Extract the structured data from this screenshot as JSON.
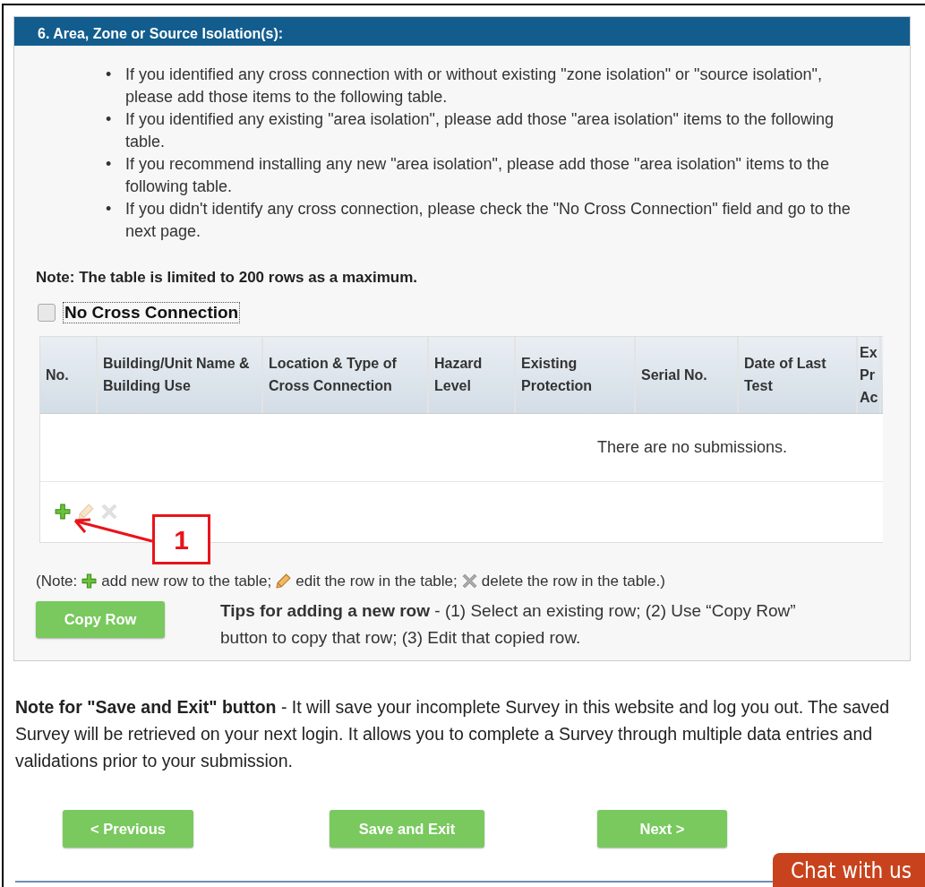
{
  "section": {
    "title": "6. Area, Zone or Source Isolation(s):"
  },
  "instructions": [
    {
      "bullet": "•",
      "text": "If you identified any cross connection with or without existing \"zone isolation\" or \"source isolation\", please add those items to the following table."
    },
    {
      "bullet": "•",
      "text": "If you identified any existing \"area isolation\", please add those \"area isolation\" items to the following table."
    },
    {
      "bullet": "•",
      "text": "If you recommend installing any new \"area isolation\", please add those \"area isolation\" items to the following table."
    },
    {
      "bullet": "•",
      "text": "If you didn't identify any cross connection, please check the \"No Cross Connection\" field and go to the next page."
    }
  ],
  "note": "Note: The table is limited to 200 rows as a maximum.",
  "no_cross_connection": {
    "label": "No Cross Connection",
    "checked": false
  },
  "table": {
    "columns": [
      "No.",
      "Building/Unit Name & Building Use",
      "Location & Type of Cross Connection",
      "Hazard Level",
      "Existing Protection",
      "Serial No.",
      "Date of Last Test",
      "Ex Pr Ac"
    ],
    "empty_message": "There are no submissions.",
    "toolbar": [
      {
        "kind": "add",
        "disabled": false
      },
      {
        "kind": "edit",
        "disabled": true
      },
      {
        "kind": "delete",
        "disabled": true
      }
    ]
  },
  "legend": {
    "prefix": "(Note:",
    "parts": [
      {
        "kind": "add",
        "text": "add new row to the table;"
      },
      {
        "kind": "edit",
        "text": "edit the row in the table;"
      },
      {
        "kind": "delete",
        "text": "delete the row in the table.)"
      }
    ]
  },
  "copy_button": "Copy Row",
  "tips": "**Tips for adding a new row** - (1) Select an existing row; (2) Use “Copy Row” button to copy that row; (3) Edit that copied row.",
  "footer_note": "**Note for \"Save and Exit\" button** - It will save your incomplete Survey in this website and log you out. The saved Survey will be retrieved on your next login. It allows you to complete a Survey through multiple data entries and validations prior to your submission.",
  "nav_buttons": [
    "< Previous",
    "Save and Exit",
    "Next >"
  ],
  "chat": "Chat with us",
  "callout": {
    "label": "1"
  }
}
